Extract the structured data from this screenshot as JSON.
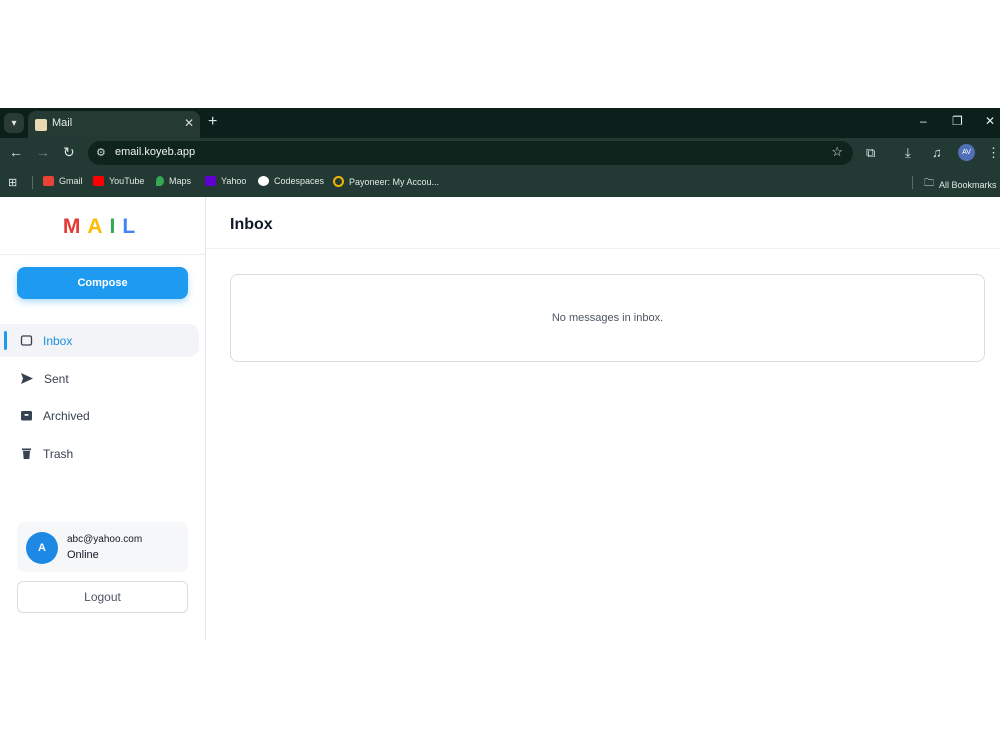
{
  "browser": {
    "tab_title": "Mail",
    "new_tab": "+",
    "url": "email.koyeb.app",
    "window_controls": [
      "–",
      "❐",
      "✕"
    ],
    "profile_initials": "AV",
    "bookmarks": [
      {
        "label": "Gmail",
        "color": "#ea4335"
      },
      {
        "label": "YouTube",
        "color": "#ff0000"
      },
      {
        "label": "Maps",
        "color": "#34a853"
      },
      {
        "label": "Yahoo",
        "color": "#6001d2"
      },
      {
        "label": "Codespaces",
        "color": "#ffffff"
      },
      {
        "label": "Payoneer: My Accou...",
        "color": "#f4b400"
      }
    ],
    "all_bookmarks": "All Bookmarks"
  },
  "app": {
    "logo_letters": [
      {
        "char": "M",
        "color": "#e53935"
      },
      {
        "char": "A",
        "color": "#fbbc05"
      },
      {
        "char": "I",
        "color": "#34a853"
      },
      {
        "char": "L",
        "color": "#4285f4"
      }
    ],
    "compose_label": "Compose",
    "nav": [
      {
        "label": "Inbox",
        "icon": "inbox-icon",
        "active": true
      },
      {
        "label": "Sent",
        "icon": "send-icon",
        "active": false
      },
      {
        "label": "Archived",
        "icon": "archive-icon",
        "active": false
      },
      {
        "label": "Trash",
        "icon": "trash-icon",
        "active": false
      }
    ],
    "user": {
      "avatar_initial": "A",
      "email": "abc@yahoo.com",
      "status": "Online"
    },
    "logout_label": "Logout",
    "main_title": "Inbox",
    "empty_message": "No messages in inbox.",
    "accent_color": "#1e9bf0"
  }
}
